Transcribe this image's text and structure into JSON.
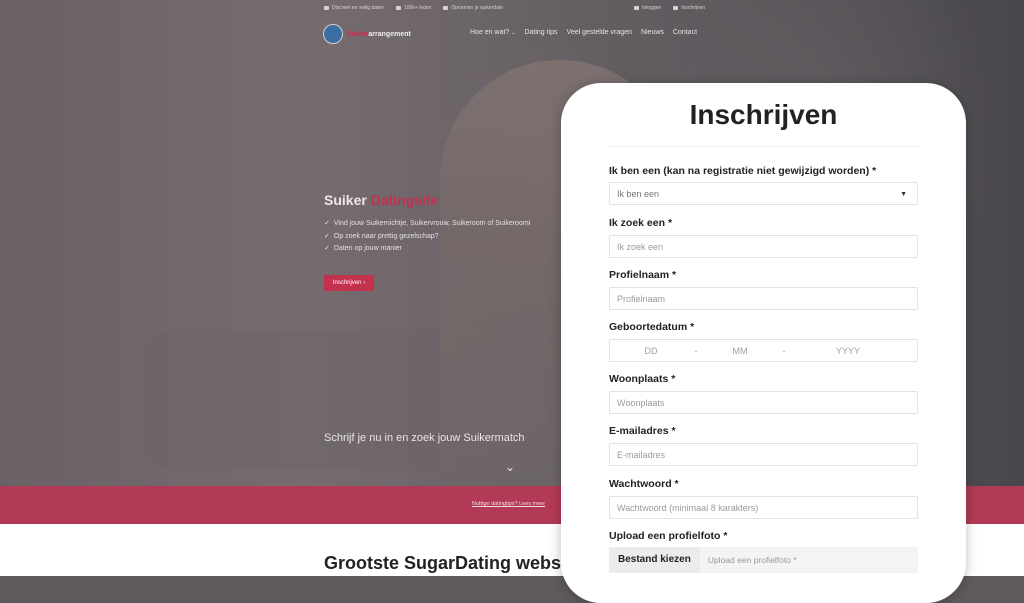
{
  "topbar": {
    "left": [
      "Discreet en veilig daten",
      "100k+ leden",
      "Opnemen je suikerdate"
    ],
    "right": [
      "Inloggen",
      "Inschrijven"
    ]
  },
  "logo": {
    "part1": "Suiker",
    "part2": "arrangement"
  },
  "nav": {
    "items": [
      "Hoe en wat?",
      "Dating tips",
      "Veel gestelde vragen",
      "Nieuws",
      "Contact"
    ]
  },
  "hero": {
    "title_a": "Suiker",
    "title_b": "Datingsite",
    "bullets": [
      "Vind jouw Suikernichtje, Suikervrouw, Suikeroom of Suikeroomi",
      "Op zoek naar prettig gezelschap?",
      "Daten op jouw manier"
    ],
    "button": "Inschrijven",
    "button_icon": "chevron-right-icon",
    "subtitle": "Schrijf je nu in en zoek jouw Suikermatch",
    "down_icon": "chevron-down-icon"
  },
  "band": {
    "link": "Nuttige datingtips? Lees meer"
  },
  "bottom": {
    "title": "Grootste SugarDating website"
  },
  "form": {
    "title": "Inschrijven",
    "fields": {
      "gender_label": "Ik ben een (kan na registratie niet gewijzigd worden) *",
      "gender_value": "Ik ben een",
      "seeking_label": "Ik zoek een *",
      "seeking_placeholder": "Ik zoek een",
      "profilename_label": "Profielnaam *",
      "profilename_placeholder": "Profielnaam",
      "birthdate_label": "Geboortedatum *",
      "birthdate_dd": "DD",
      "birthdate_mm": "MM",
      "birthdate_yyyy": "YYYY",
      "birthdate_sep": "-",
      "city_label": "Woonplaats *",
      "city_placeholder": "Woonplaats",
      "email_label": "E-mailadres *",
      "email_placeholder": "E-mailadres",
      "password_label": "Wachtwoord *",
      "password_placeholder": "Wachtwoord (minimaal 8 karakters)",
      "photo_label": "Upload een profielfoto *",
      "photo_button": "Bestand kiezen",
      "photo_placeholder": "Upload een profielfoto *"
    }
  },
  "colors": {
    "accent": "#c3314f",
    "band": "#b33a56"
  }
}
